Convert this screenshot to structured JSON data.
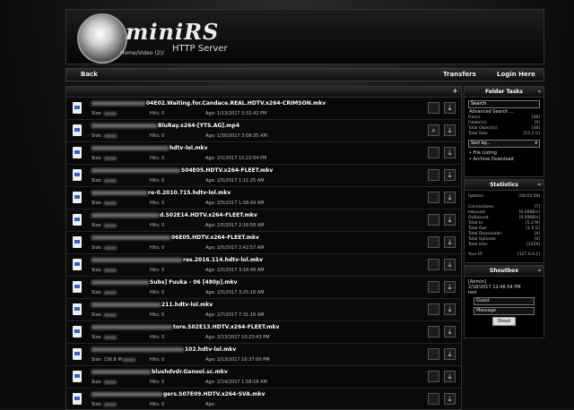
{
  "header": {
    "logo_text": "mini",
    "logo_rs": "RS",
    "server_title": "HTTP Server",
    "path": "Home/Video (2)/"
  },
  "nav": {
    "back": "Back",
    "transfers": "Transfers",
    "login": "Login Here"
  },
  "list": {
    "add_icon": "+",
    "rows": [
      {
        "name": "04E02.Waiting.for.Candace.REAL.HDTV.x264-CRIMSON.mkv",
        "size": "Size:",
        "hits": "Hits: 0",
        "age": "Age: 1/13/2017 3:32:42 PM",
        "extra_btn": false
      },
      {
        "name": "BluRay.x264-[YTS.AG].mp4",
        "size": "Size:",
        "hits": "Hits: 0",
        "age": "Age: 1/30/2017 3:09:35 AM",
        "extra_btn": true
      },
      {
        "name": "hdtv-lol.mkv",
        "size": "Size:",
        "hits": "Hits: 0",
        "age": "Age: 2/1/2017 10:22:04 PM",
        "extra_btn": false
      },
      {
        "name": "S04E05.HDTV.x264-FLEET.mkv",
        "size": "Size:",
        "hits": "Hits: 0",
        "age": "Age: 2/5/2017 1:11:25 AM",
        "extra_btn": false
      },
      {
        "name": "re-0.2010.715.hdtv-lol.mkv",
        "size": "Size:",
        "hits": "Hits: 0",
        "age": "Age: 2/5/2017 1:58:49 AM",
        "extra_btn": false
      },
      {
        "name": "d.S02E14.HDTV.x264-FLEET.mkv",
        "size": "Size:",
        "hits": "Hits: 0",
        "age": "Age: 2/5/2017 2:16:58 AM",
        "extra_btn": false
      },
      {
        "name": "06E05.HDTV.x264-FLEET.mkv",
        "size": "Size:",
        "hits": "Hits: 0",
        "age": "Age: 2/5/2017 2:42:57 AM",
        "extra_btn": false
      },
      {
        "name": "res.2016.114.hdtv-lol.mkv",
        "size": "Size:",
        "hits": "Hits: 0",
        "age": "Age: 2/5/2017 3:18:48 AM",
        "extra_btn": false
      },
      {
        "name": "Subs] Fuuka - 06 [480p].mkv",
        "size": "Size:",
        "hits": "Hits: 0",
        "age": "Age: 2/5/2017 3:25:16 AM",
        "extra_btn": false
      },
      {
        "name": "211.hdtv-lol.mkv",
        "size": "Size:",
        "hits": "Hits: 0",
        "age": "Age: 2/7/2017 7:31:16 AM",
        "extra_btn": false
      },
      {
        "name": "tore.S02E13.HDTV.x264-FLEET.mkv",
        "size": "Size:",
        "hits": "Hits: 0",
        "age": "Age: 2/13/2017 10:23:43 PM",
        "extra_btn": false
      },
      {
        "name": "102.hdtv-lol.mkv",
        "size": "Size: 136.8 M",
        "hits": "Hits: 0",
        "age": "Age: 2/13/2017 10:37:00 PM",
        "extra_btn": false
      },
      {
        "name": "blushdvdr.Ganool.sc.mkv",
        "size": "Size:",
        "hits": "Hits: 0",
        "age": "Age: 2/14/2017 1:58:18 AM",
        "extra_btn": false
      },
      {
        "name": "gers.S07E09.HDTV.x264-SVA.mkv",
        "size": "Size:",
        "hits": "Hits: 0",
        "age": "Age:",
        "extra_btn": false
      }
    ]
  },
  "folder_tasks": {
    "title": "Folder Tasks",
    "search_label": "Search",
    "advanced": "Advanced Search ...",
    "stats": [
      {
        "k": "File(s):",
        "v": "[48]"
      },
      {
        "k": "Folder(s):",
        "v": "[0]"
      },
      {
        "k": "Total Object(s):",
        "v": "[48]"
      },
      {
        "k": "Total Size:",
        "v": "[12.2 G]"
      }
    ],
    "sort_label": "Sort by...",
    "file_listing": "File Listing",
    "archive_download": "Archive Download"
  },
  "statistics": {
    "title": "Statistics",
    "uptime": {
      "k": "Uptime:",
      "v": "[00:03:59]"
    },
    "rows": [
      {
        "k": "Connections:",
        "v": "[7]"
      },
      {
        "k": "Inbound:",
        "v": "[0.00KB/s]"
      },
      {
        "k": "Outbound:",
        "v": "[0.00KB/s]"
      },
      {
        "k": "Total In:",
        "v": "[5.2 M]"
      },
      {
        "k": "Total Out:",
        "v": "[1.5 G]"
      },
      {
        "k": "Total Downloads:",
        "v": "[4]"
      },
      {
        "k": "Total Uploads:",
        "v": "[0]"
      },
      {
        "k": "Total Hits:",
        "v": "[1259]"
      }
    ],
    "ip": {
      "k": "Your IP:",
      "v": "[127.0.0.1]"
    }
  },
  "shoutbox": {
    "title": "Shoutbox",
    "user": "[Admin]",
    "time": "2/18/2017 12:48:54 PM",
    "msg": "test",
    "name_placeholder": "Guest",
    "message_placeholder": "Message",
    "button": "Shout"
  },
  "colors": {
    "accent": "#ffffff",
    "panel_bg": "#000000"
  }
}
